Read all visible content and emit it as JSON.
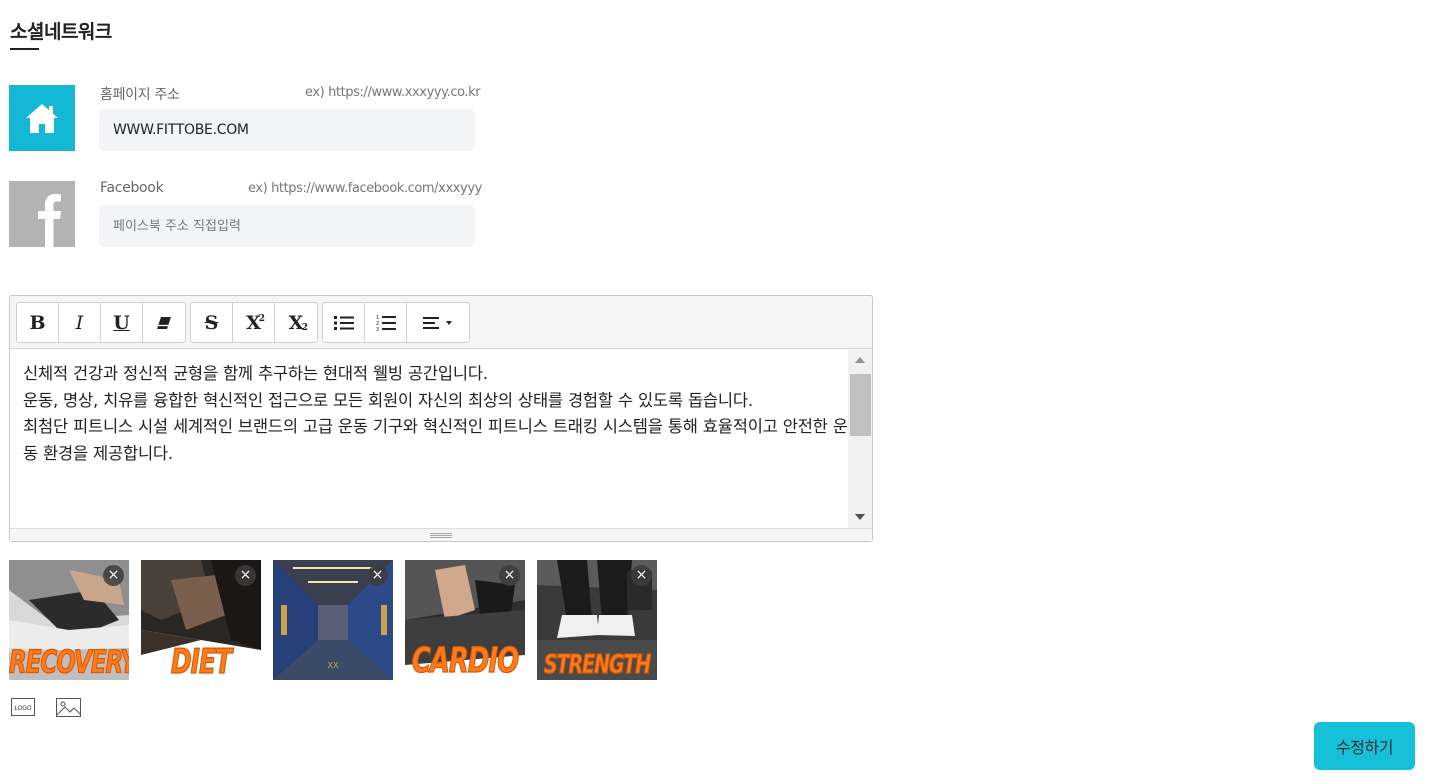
{
  "section": {
    "title": "소셜네트워크"
  },
  "homepage": {
    "label": "홈페이지 주소",
    "example": "ex) https://www.xxxyyy.co.kr",
    "value": "WWW.FITTOBE.COM",
    "icon": "home-icon",
    "color": "#14b8d4"
  },
  "facebook": {
    "label": "Facebook",
    "example": "ex) https://www.facebook.com/xxxyyy",
    "placeholder": "페이스북 주소 직접입력",
    "value": "",
    "icon": "facebook-icon",
    "color": "#b3b3b3"
  },
  "editor": {
    "toolbar": {
      "bold": "B",
      "italic": "I",
      "underline": "U",
      "eraser": "eraser-icon",
      "strikethrough": "S",
      "superscript": "X",
      "superscript_mark": "2",
      "subscript": "X",
      "subscript_mark": "2",
      "unordered_list": "list-ul-icon",
      "ordered_list": "list-ol-icon",
      "align": "align-left-icon"
    },
    "paragraphs": [
      "신체적 건강과 정신적 균형을 함께 추구하는 현대적 웰빙 공간입니다.",
      "",
      "운동, 명상, 치유를 융합한 혁신적인 접근으로 모든 회원이 자신의 최상의 상태를 경험할 수 있도록 돕습니다.",
      "",
      "최첨단 피트니스 시설 세계적인 브랜드의 고급 운동 기구와 혁신적인 피트니스 트래킹 시스템을 통해 효율적이고 안전한 운동 환경을 제공합니다."
    ]
  },
  "images": [
    {
      "label": "RECOVERY",
      "remove": "×"
    },
    {
      "label": "DIET",
      "remove": "×"
    },
    {
      "label": "",
      "remove": "×"
    },
    {
      "label": "CARDIO",
      "remove": "×"
    },
    {
      "label": "STRENGTH",
      "remove": "×"
    }
  ],
  "upload": {
    "logo_icon_text": "LOGO",
    "image_icon": "image-icon"
  },
  "submit": {
    "label": "수정하기",
    "color": "#16c0d8"
  }
}
